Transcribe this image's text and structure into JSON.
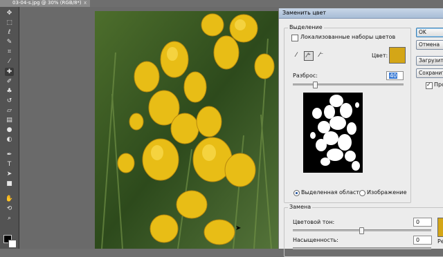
{
  "document": {
    "tab_title": "03-04-s.jpg @ 30% (RGB/8*)",
    "close_glyph": "x"
  },
  "colors": {
    "swatch": "#d4a617",
    "result_swatch": "#d4a617"
  },
  "toolbar": {
    "tools": [
      "move-icon",
      "marquee-icon",
      "lasso-icon",
      "quick-select-icon",
      "crop-icon",
      "eyedropper-icon",
      "healing-icon",
      "brush-icon",
      "clone-stamp-icon",
      "history-brush-icon",
      "eraser-icon",
      "gradient-icon",
      "blur-icon",
      "dodge-icon",
      "pen-icon",
      "type-icon",
      "path-select-icon",
      "shape-icon",
      "hand-icon",
      "rotate-icon",
      "zoom-icon"
    ]
  },
  "dialog": {
    "title": "Заменить цвет",
    "selection": {
      "legend": "Выделение",
      "localized_label": "Локализованные наборы цветов",
      "color_label": "Цвет:",
      "fuzziness_label": "Разброс:",
      "fuzziness_value": "40",
      "fuzziness_level": 0.2,
      "radio_selection": "Выделенная область",
      "radio_image": "Изображение"
    },
    "replace": {
      "legend": "Замена",
      "hue_label": "Цветовой тон:",
      "hue_value": "0",
      "saturation_label": "Насыщенность:",
      "saturation_value": "0",
      "result_label": "Ре"
    },
    "buttons": {
      "ok": "OK",
      "cancel": "Отмена",
      "load": "Загрузить...",
      "save": "Сохранить...",
      "preview": "Просмотр"
    }
  }
}
